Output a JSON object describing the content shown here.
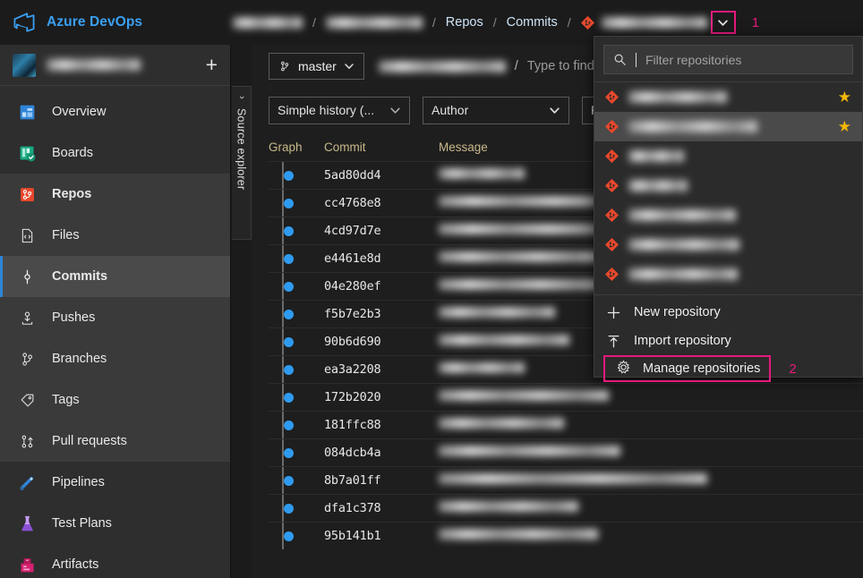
{
  "header": {
    "brand": "Azure DevOps",
    "logo_icon": "azure-devops-logo",
    "breadcrumb": {
      "org_redacted": "",
      "project_redacted": "",
      "items": [
        {
          "label": "Repos"
        },
        {
          "label": "Commits"
        }
      ],
      "repo_icon": "git-repo-icon",
      "repo_name_redacted": "",
      "chevron_icon": "chevron-down-icon",
      "annotation": "1"
    }
  },
  "sidebar": {
    "project": {
      "avatar_icon": "project-avatar",
      "name_redacted": "",
      "add_label": "+"
    },
    "items": [
      {
        "label": "Overview",
        "icon": "overview-icon",
        "selected": false
      },
      {
        "label": "Boards",
        "icon": "boards-icon",
        "selected": false
      },
      {
        "label": "Repos",
        "icon": "repos-icon",
        "selected": false
      },
      {
        "label": "Files",
        "icon": "files-icon",
        "selected": false
      },
      {
        "label": "Commits",
        "icon": "commits-icon",
        "selected": true
      },
      {
        "label": "Pushes",
        "icon": "pushes-icon",
        "selected": false
      },
      {
        "label": "Branches",
        "icon": "branches-icon",
        "selected": false
      },
      {
        "label": "Tags",
        "icon": "tags-icon",
        "selected": false
      },
      {
        "label": "Pull requests",
        "icon": "pull-requests-icon",
        "selected": false
      },
      {
        "label": "Pipelines",
        "icon": "pipelines-icon",
        "selected": false
      },
      {
        "label": "Test Plans",
        "icon": "test-plans-icon",
        "selected": false
      },
      {
        "label": "Artifacts",
        "icon": "artifacts-icon",
        "selected": false
      }
    ]
  },
  "source_explorer": {
    "label": "Source explorer",
    "chevron_icon": "chevron-right-icon"
  },
  "toolbar": {
    "branch": {
      "label": "master",
      "icon": "branch-icon",
      "chevron_icon": "chevron-down-icon"
    },
    "path": {
      "repo_redacted": "",
      "separator": "/",
      "find_placeholder": "Type to find a fil"
    },
    "filters": [
      {
        "label": "Simple history (...",
        "name": "history-mode-dropdown"
      },
      {
        "label": "Author",
        "name": "author-dropdown"
      },
      {
        "label": "Fro",
        "name": "from-date-dropdown"
      }
    ]
  },
  "commits_table": {
    "columns": [
      "Graph",
      "Commit",
      "Message"
    ],
    "rows": [
      {
        "hash": "5ad80dd4",
        "msg_width": 96
      },
      {
        "hash": "cc4768e8",
        "msg_width": 215
      },
      {
        "hash": "4cd97d7e",
        "msg_width": 205
      },
      {
        "hash": "e4461e8d",
        "msg_width": 186
      },
      {
        "hash": "04e280ef",
        "msg_width": 191
      },
      {
        "hash": "f5b7e2b3",
        "msg_width": 130
      },
      {
        "hash": "90b6d690",
        "msg_width": 146
      },
      {
        "hash": "ea3a2208",
        "msg_width": 96
      },
      {
        "hash": "172b2020",
        "msg_width": 190
      },
      {
        "hash": "181ffc88",
        "msg_width": 140
      },
      {
        "hash": "084dcb4a",
        "msg_width": 203
      },
      {
        "hash": "8b7a01ff",
        "msg_width": 300
      },
      {
        "hash": "dfa1c378",
        "msg_width": 156
      },
      {
        "hash": "95b141b1",
        "msg_width": 178
      }
    ]
  },
  "repo_panel": {
    "filter": {
      "placeholder": "Filter repositories",
      "icon": "search-icon"
    },
    "repos": [
      {
        "name_redacted": "",
        "width": 110,
        "starred": true,
        "highlighted": false
      },
      {
        "name_redacted": "",
        "width": 144,
        "starred": true,
        "highlighted": true
      },
      {
        "name_redacted": "",
        "width": 62,
        "starred": false,
        "highlighted": false
      },
      {
        "name_redacted": "",
        "width": 66,
        "starred": false,
        "highlighted": false
      },
      {
        "name_redacted": "",
        "width": 120,
        "starred": false,
        "highlighted": false
      },
      {
        "name_redacted": "",
        "width": 124,
        "starred": false,
        "highlighted": false
      },
      {
        "name_redacted": "",
        "width": 122,
        "starred": false,
        "highlighted": false
      }
    ],
    "star_glyph": "★",
    "actions": [
      {
        "label": "New repository",
        "icon": "plus-icon"
      },
      {
        "label": "Import repository",
        "icon": "import-arrow-icon"
      },
      {
        "label": "Manage repositories",
        "icon": "gear-icon",
        "highlighted": true
      }
    ],
    "annotation": "2"
  },
  "colors": {
    "accent_blue": "#3aa0f3",
    "highlight_magenta": "#e8197d",
    "graph_dot": "#2f9bf0",
    "star_gold": "#f2b705",
    "repo_icon_red": "#e8482c",
    "column_header": "#c9b98a"
  }
}
